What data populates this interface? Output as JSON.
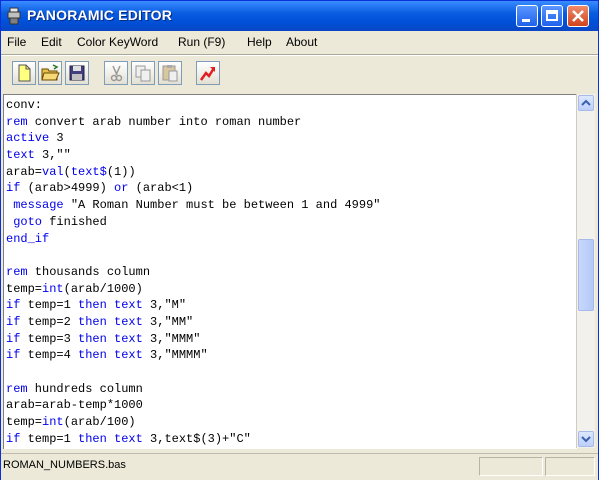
{
  "window": {
    "title": "PANORAMIC EDITOR"
  },
  "menu": [
    "File",
    "Edit",
    "Color KeyWord",
    "Run (F9)",
    "Help",
    "About"
  ],
  "toolbar": {
    "tools": [
      "new-file-icon",
      "open-folder-icon",
      "save-disk-icon",
      "cut-scissors-icon",
      "copy-icon",
      "paste-icon",
      "run-arrow-icon"
    ]
  },
  "editor": {
    "lines": [
      [
        {
          "t": "conv:"
        }
      ],
      [
        {
          "t": "rem",
          "k": 1
        },
        {
          "t": " convert arab number into roman number"
        }
      ],
      [
        {
          "t": "active",
          "k": 1
        },
        {
          "t": " 3"
        }
      ],
      [
        {
          "t": "text",
          "k": 1
        },
        {
          "t": " 3,\"\""
        }
      ],
      [
        {
          "t": "arab="
        },
        {
          "t": "val",
          "k": 1
        },
        {
          "t": "("
        },
        {
          "t": "text$",
          "k": 1
        },
        {
          "t": "(1))"
        }
      ],
      [
        {
          "t": "if",
          "k": 1
        },
        {
          "t": " (arab>4999) "
        },
        {
          "t": "or",
          "k": 1
        },
        {
          "t": " (arab<1)"
        }
      ],
      [
        {
          "t": " "
        },
        {
          "t": "message",
          "k": 1
        },
        {
          "t": " \"A Roman Number must be between 1 and 4999\""
        }
      ],
      [
        {
          "t": " "
        },
        {
          "t": "goto",
          "k": 1
        },
        {
          "t": " finished"
        }
      ],
      [
        {
          "t": "end_if",
          "k": 1
        }
      ],
      [
        {
          "t": ""
        }
      ],
      [
        {
          "t": "rem",
          "k": 1
        },
        {
          "t": " thousands column"
        }
      ],
      [
        {
          "t": "temp="
        },
        {
          "t": "int",
          "k": 1
        },
        {
          "t": "(arab/1000)"
        }
      ],
      [
        {
          "t": "if",
          "k": 1
        },
        {
          "t": " temp=1 "
        },
        {
          "t": "then",
          "k": 1
        },
        {
          "t": " "
        },
        {
          "t": "text",
          "k": 1
        },
        {
          "t": " 3,\"M\""
        }
      ],
      [
        {
          "t": "if",
          "k": 1
        },
        {
          "t": " temp=2 "
        },
        {
          "t": "then",
          "k": 1
        },
        {
          "t": " "
        },
        {
          "t": "text",
          "k": 1
        },
        {
          "t": " 3,\"MM\""
        }
      ],
      [
        {
          "t": "if",
          "k": 1
        },
        {
          "t": " temp=3 "
        },
        {
          "t": "then",
          "k": 1
        },
        {
          "t": " "
        },
        {
          "t": "text",
          "k": 1
        },
        {
          "t": " 3,\"MMM\""
        }
      ],
      [
        {
          "t": "if",
          "k": 1
        },
        {
          "t": " temp=4 "
        },
        {
          "t": "then",
          "k": 1
        },
        {
          "t": " "
        },
        {
          "t": "text",
          "k": 1
        },
        {
          "t": " 3,\"MMMM\""
        }
      ],
      [
        {
          "t": ""
        }
      ],
      [
        {
          "t": "rem",
          "k": 1
        },
        {
          "t": " hundreds column"
        }
      ],
      [
        {
          "t": "arab=arab-temp*1000"
        }
      ],
      [
        {
          "t": "temp="
        },
        {
          "t": "int",
          "k": 1
        },
        {
          "t": "(arab/100)"
        }
      ],
      [
        {
          "t": "if",
          "k": 1
        },
        {
          "t": " temp=1 "
        },
        {
          "t": "then",
          "k": 1
        },
        {
          "t": " "
        },
        {
          "t": "text",
          "k": 1
        },
        {
          "t": " 3,text$(3)+\"C\""
        }
      ]
    ]
  },
  "status": {
    "file": "ROMAN_NUMBERS.bas"
  },
  "colors": {
    "keyword": "#0000ee",
    "titlebar": "#0a5de0",
    "chrome": "#ece9d8"
  }
}
